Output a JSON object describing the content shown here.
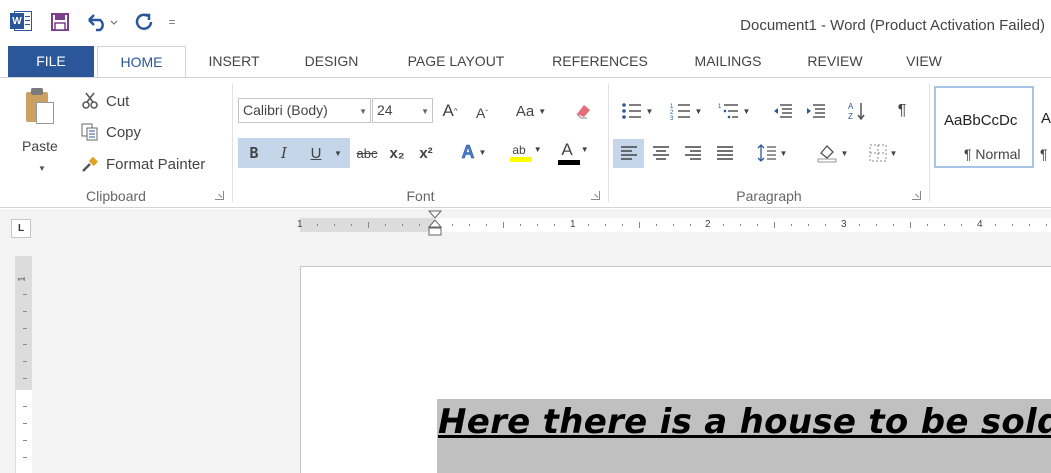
{
  "window": {
    "title": "Document1 - Word (Product Activation Failed)"
  },
  "qat": {
    "customize_glyph": "="
  },
  "tabs": [
    "FILE",
    "HOME",
    "INSERT",
    "DESIGN",
    "PAGE LAYOUT",
    "REFERENCES",
    "MAILINGS",
    "REVIEW",
    "VIEW"
  ],
  "clipboard": {
    "paste_label": "Paste",
    "cut_label": "Cut",
    "copy_label": "Copy",
    "format_painter_label": "Format Painter",
    "group_label": "Clipboard"
  },
  "font": {
    "font_name": "Calibri (Body)",
    "font_size": "24",
    "change_case": "Aa",
    "bold": "B",
    "italic": "I",
    "underline": "U",
    "strikethrough": "abc",
    "subscript": "x₂",
    "superscript": "x²",
    "highlight": "ab",
    "font_color": "A",
    "group_label": "Font"
  },
  "paragraph": {
    "group_label": "Paragraph",
    "show_marks": "¶"
  },
  "styles": {
    "sample": "AaBbCcDc",
    "name": "¶ Normal",
    "next_sample": "A",
    "next_name": "¶"
  },
  "ruler": {
    "numbers": [
      "1",
      "1",
      "2",
      "3",
      "4"
    ],
    "tab_type": "L",
    "vertical_number": "1"
  },
  "document": {
    "headline": "Here there is a house to be sold"
  },
  "colors": {
    "accent": "#2b579a",
    "highlight": "#c5d5ea",
    "text_highlight": "#c0c0c0"
  }
}
